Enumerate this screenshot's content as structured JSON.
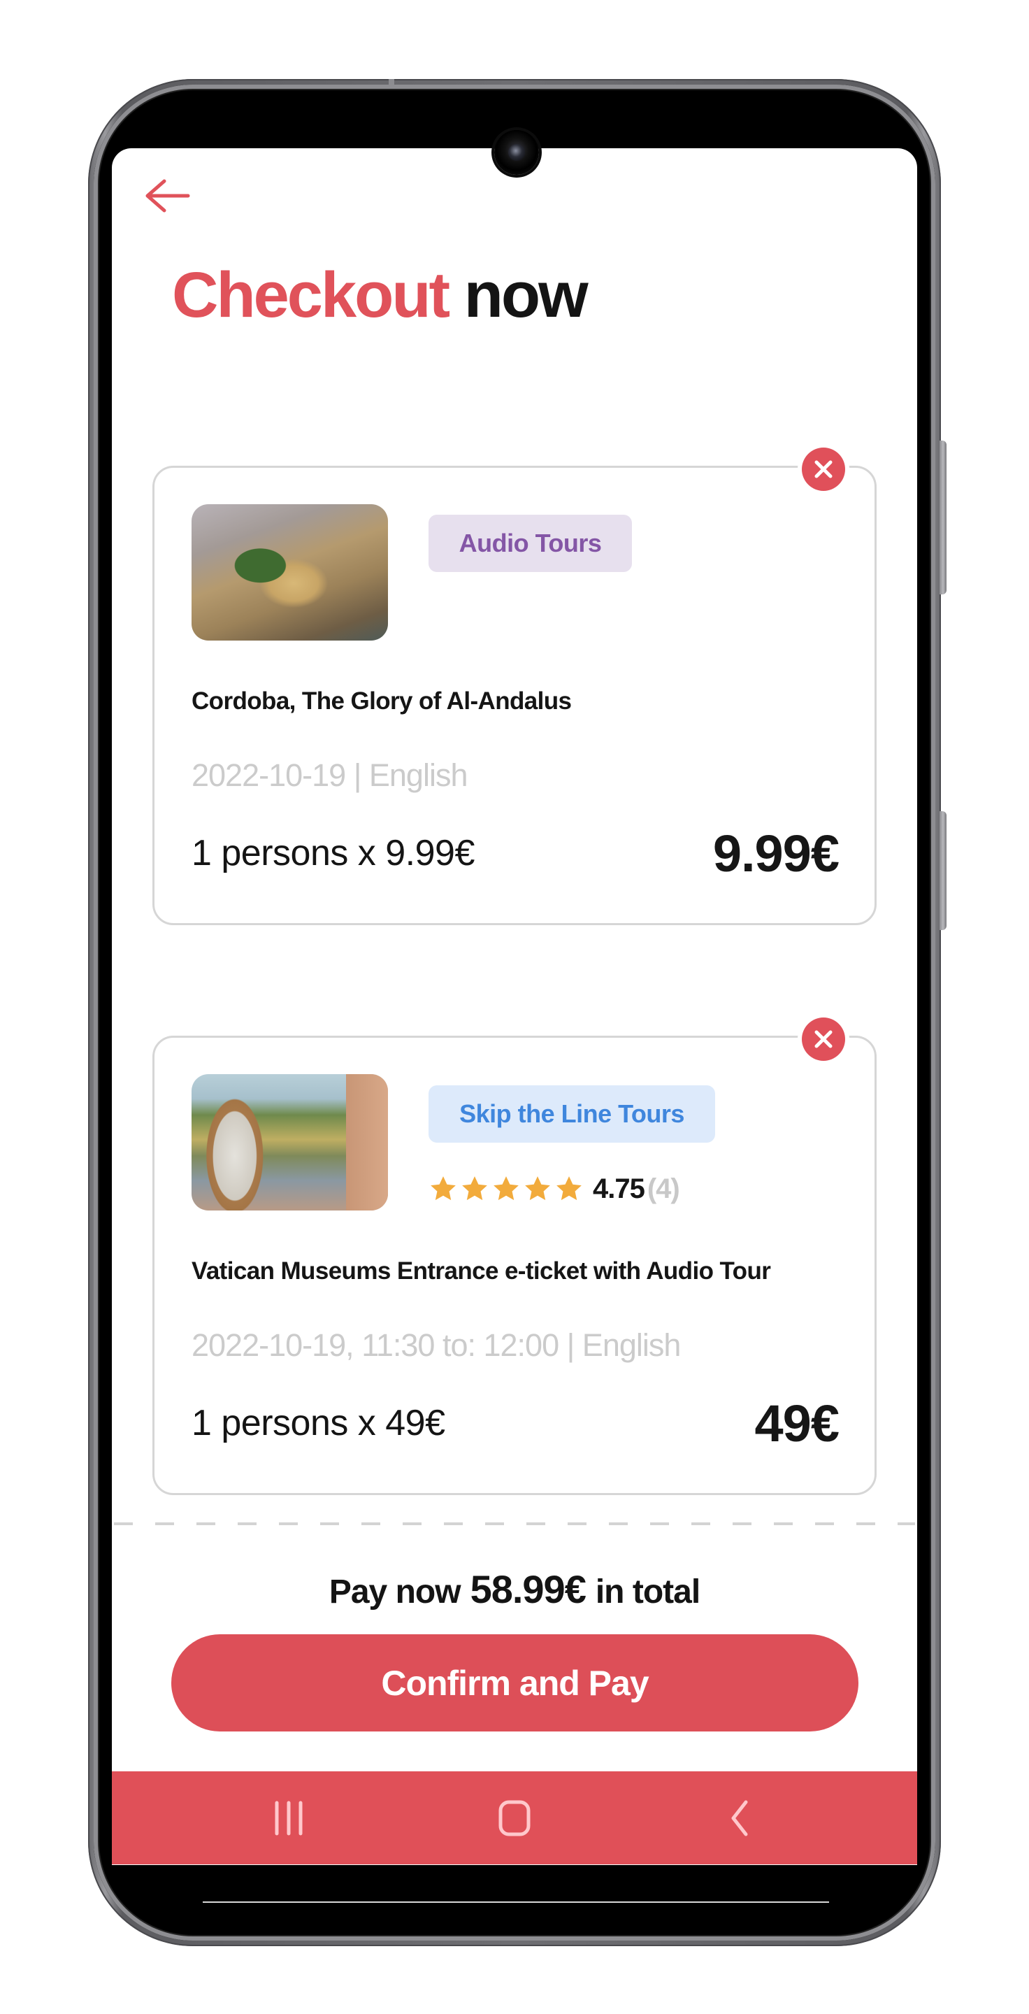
{
  "header": {
    "back_icon": "arrow-left-icon",
    "title_accent": "Checkout",
    "title_rest": "now"
  },
  "colors": {
    "accent": "#e0525a",
    "badge_audio_bg": "#e7e0ee",
    "badge_audio_text": "#8456a6",
    "badge_skip_bg": "#ddeafb",
    "badge_skip_text": "#3f86dd",
    "star": "#f2ab3c",
    "navbar": "#e05058"
  },
  "cart": {
    "items": [
      {
        "category": "Audio Tours",
        "title": "Cordoba, The Glory of Al-Andalus",
        "meta": "2022-10-19 | English",
        "quantity_line": "1 persons x 9.99€",
        "price": "9.99€",
        "image_alt": "Aerial view of the Mosque-Cathedral of Cordoba",
        "remove_icon": "close-icon"
      },
      {
        "category": "Skip the Line Tours",
        "rating": {
          "value": "4.75",
          "count": "(4)",
          "stars": 5,
          "max_stars": 5
        },
        "title": "Vatican Museums Entrance e-ticket with Audio Tour",
        "meta": "2022-10-19, 11:30 to: 12:00 | English",
        "quantity_line": "1 persons x 49€",
        "price": "49€",
        "image_alt": "Hand holding phone with e-ticket in front of Vatican gardens",
        "remove_icon": "close-icon"
      }
    ]
  },
  "summary": {
    "prefix": "Pay now",
    "total": "58.99€",
    "suffix": "in total"
  },
  "actions": {
    "confirm_label": "Confirm and Pay"
  },
  "system_nav": {
    "recents_icon": "recent-apps-icon",
    "home_icon": "home-icon",
    "back_icon": "back-chevron-icon"
  }
}
